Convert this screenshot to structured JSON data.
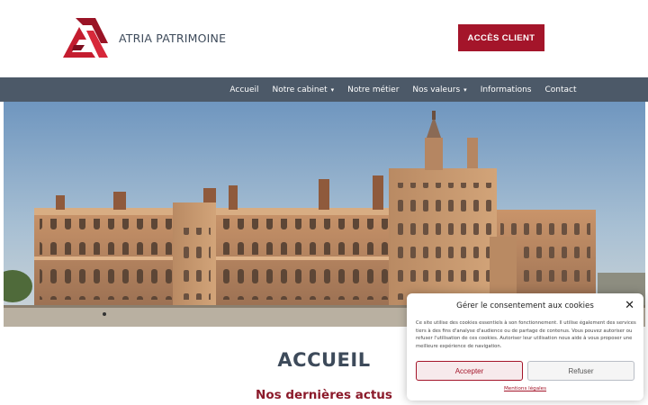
{
  "header": {
    "brand": "ATRIA PATRIMOINE",
    "cta_label": "ACCÈS CLIENT",
    "logo_icon": "triangle-logo-icon"
  },
  "nav": {
    "items": [
      {
        "label": "Accueil",
        "has_dropdown": false
      },
      {
        "label": "Notre cabinet",
        "has_dropdown": true
      },
      {
        "label": "Notre métier",
        "has_dropdown": false
      },
      {
        "label": "Nos valeurs",
        "has_dropdown": true
      },
      {
        "label": "Informations",
        "has_dropdown": false
      },
      {
        "label": "Contact",
        "has_dropdown": false
      }
    ],
    "caret_glyph": "▾"
  },
  "hero": {
    "image": "chateau-panorama-image"
  },
  "main": {
    "title": "ACCUEIL",
    "subtitle": "Nos dernières actus"
  },
  "cookie": {
    "title": "Gérer le consentement aux cookies",
    "close_glyph": "✕",
    "text": "Ce site utilise des cookies essentiels à son fonctionnement. Il utilise également des services tiers à des fins d'analyse d'audience ou de partage de contenus. Vous pouvez autoriser ou refuser l'utilisation de ces cookies. Autoriser leur utilisation nous aide à vous proposer une meilleure expérience de navigation.",
    "accept_label": "Accepter",
    "refuse_label": "Refuser",
    "link_label": "Mentions légales"
  },
  "colors": {
    "accent": "#a4152a",
    "nav_bg": "#4c5968",
    "text_dark": "#3d4a5a",
    "subtitle": "#8b1a2a"
  }
}
